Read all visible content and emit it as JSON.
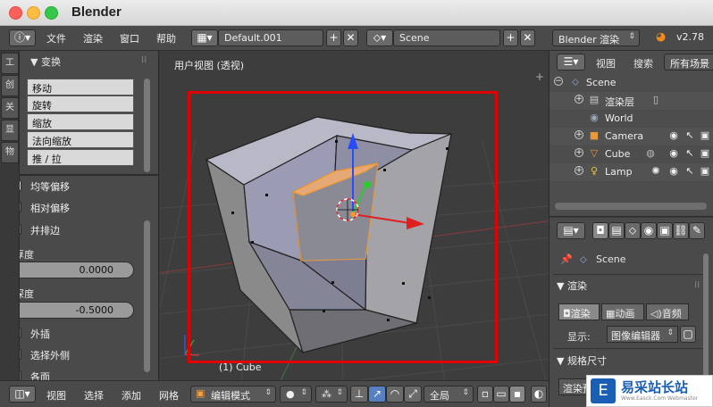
{
  "window": {
    "title": "Blender"
  },
  "topbar": {
    "menus": [
      "文件",
      "渲染",
      "窗口",
      "帮助"
    ],
    "screen_layout": "Default.001",
    "scene": "Scene",
    "render_engine": "Blender 渲染",
    "version": "v2.78"
  },
  "toolshelf": {
    "tabs": [
      "工",
      "创",
      "关",
      "显",
      "物"
    ],
    "transform_header": "变换",
    "transform_buttons": [
      "移动",
      "旋转",
      "缩放",
      "法向缩放",
      "推 / 拉"
    ],
    "options": [
      {
        "label": "均等偏移",
        "checked": true
      },
      {
        "label": "相对偏移",
        "checked": false
      },
      {
        "label": "并排边",
        "checked": false
      }
    ],
    "thickness": {
      "label": "厚度",
      "value": "0.0000"
    },
    "depth": {
      "label": "深度",
      "value": "-0.5000"
    },
    "options2": [
      {
        "label": "外插",
        "checked": false
      },
      {
        "label": "选择外侧",
        "checked": false
      },
      {
        "label": "各面",
        "checked": false
      }
    ]
  },
  "viewport": {
    "title": "用户视图 (透视)",
    "object_label": "(1) Cube",
    "highlight_color": "#e00000",
    "selected_face_color": "#e6a874"
  },
  "bottombar": {
    "menus": [
      "视图",
      "选择",
      "添加",
      "网格"
    ],
    "mode": "编辑模式",
    "pivot": "全局"
  },
  "outliner": {
    "tabs": [
      "视图",
      "搜索"
    ],
    "filter": "所有场景",
    "items": [
      {
        "label": "Scene",
        "icon": "scene-icon"
      },
      {
        "label": "渲染层",
        "icon": "render-layers-icon"
      },
      {
        "label": "World",
        "icon": "world-icon"
      },
      {
        "label": "Camera",
        "icon": "camera-icon"
      },
      {
        "label": "Cube",
        "icon": "mesh-icon"
      },
      {
        "label": "Lamp",
        "icon": "lamp-icon"
      }
    ]
  },
  "properties": {
    "context": "Scene",
    "render_header": "渲染",
    "render_buttons": [
      "渲染",
      "动画",
      "音频"
    ],
    "display_label": "显示:",
    "display_value": "图像编辑器",
    "dimensions_header": "规格尺寸",
    "preset_label": "渲染预"
  },
  "watermark": {
    "text": "易采站长站",
    "sub": "Www.Easck.Com Webmaster",
    "logo": "E"
  }
}
